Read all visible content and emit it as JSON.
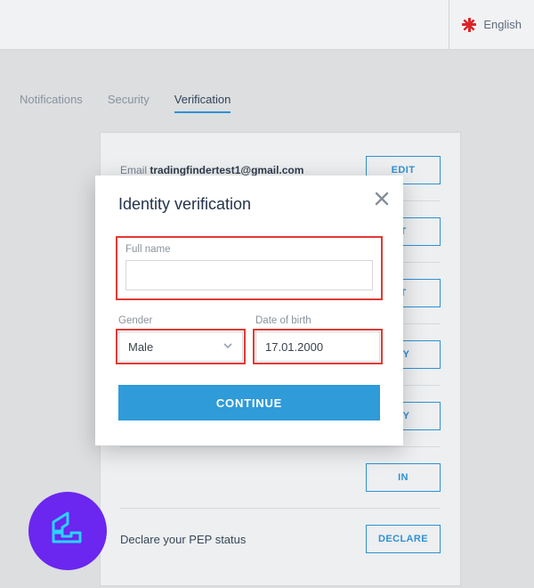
{
  "header": {
    "language_label": "English"
  },
  "tabs": {
    "notifications": "Notifications",
    "security": "Security",
    "verification": "Verification"
  },
  "panel": {
    "email_label": "Email",
    "email_value": "tradingfindertest1@gmail.com",
    "buttons": {
      "edit": "EDIT",
      "t1": "T",
      "t2": "T",
      "fy1": "FY",
      "fy2": "FY",
      "in": "IN",
      "declare": "DECLARE"
    },
    "pep_label": "Declare your PEP status"
  },
  "modal": {
    "title": "Identity verification",
    "fullname_label": "Full name",
    "fullname_value": "",
    "gender_label": "Gender",
    "gender_value": "Male",
    "dob_label": "Date of birth",
    "dob_value": "17.01.2000",
    "continue_label": "CONTINUE"
  }
}
